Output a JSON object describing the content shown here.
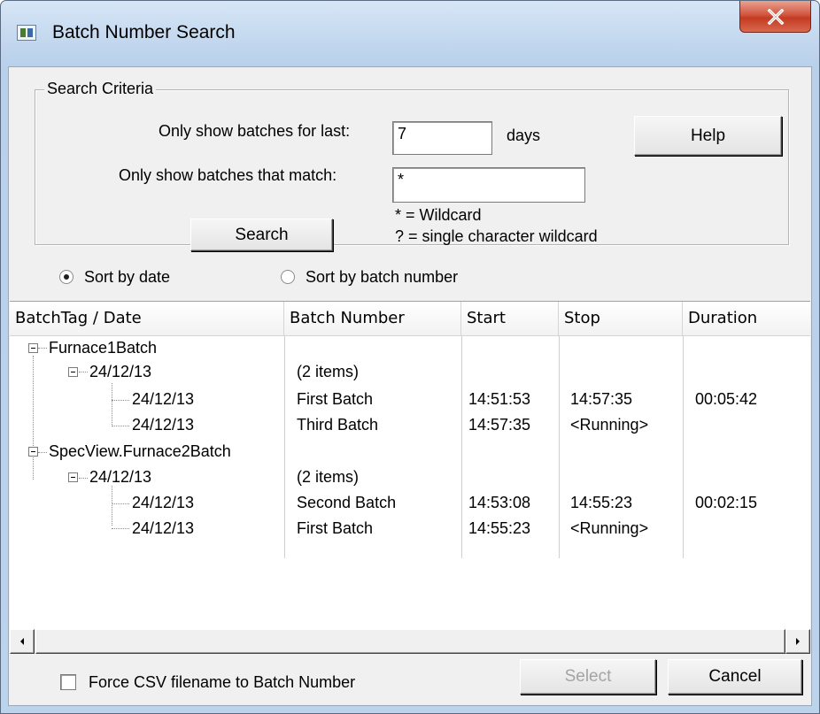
{
  "window": {
    "title": "Batch Number Search",
    "icon": "app-window-icon",
    "close_icon": "close-x-icon"
  },
  "search_criteria": {
    "group_title": "Search Criteria",
    "last_label": "Only show batches for last:",
    "last_value": "7",
    "days_label": "days",
    "match_label": "Only show batches that match:",
    "match_value": "*",
    "wildcard_hint": "* = Wildcard",
    "single_hint": "? = single character wildcard",
    "search_button": "Search",
    "help_button": "Help"
  },
  "sort": {
    "by_date": {
      "label": "Sort by date",
      "selected": true
    },
    "by_batch": {
      "label": "Sort by batch number",
      "selected": false
    }
  },
  "list": {
    "columns": [
      "BatchTag / Date",
      "Batch Number",
      "Start",
      "Stop",
      "Duration"
    ],
    "rows": [
      {
        "level": 0,
        "name": "Furnace1Batch",
        "batch": "",
        "start": "",
        "stop": "",
        "duration": ""
      },
      {
        "level": 1,
        "name": "24/12/13",
        "batch": "(2 items)",
        "start": "",
        "stop": "",
        "duration": ""
      },
      {
        "level": 2,
        "name": "24/12/13",
        "batch": "First Batch",
        "start": "14:51:53",
        "stop": "14:57:35",
        "duration": "00:05:42"
      },
      {
        "level": 2,
        "name": "24/12/13",
        "batch": "Third Batch",
        "start": "14:57:35",
        "stop": "<Running>",
        "duration": ""
      },
      {
        "level": 0,
        "name": "SpecView.Furnace2Batch",
        "batch": "",
        "start": "",
        "stop": "",
        "duration": ""
      },
      {
        "level": 1,
        "name": "24/12/13",
        "batch": "(2 items)",
        "start": "",
        "stop": "",
        "duration": ""
      },
      {
        "level": 2,
        "name": "24/12/13",
        "batch": "Second Batch",
        "start": "14:53:08",
        "stop": "14:55:23",
        "duration": "00:02:15"
      },
      {
        "level": 2,
        "name": "24/12/13",
        "batch": "First Batch",
        "start": "14:55:23",
        "stop": "<Running>",
        "duration": ""
      }
    ]
  },
  "footer": {
    "force_csv_label": "Force CSV filename to Batch Number",
    "force_csv_checked": false,
    "select_button": "Select",
    "select_enabled": false,
    "cancel_button": "Cancel"
  }
}
